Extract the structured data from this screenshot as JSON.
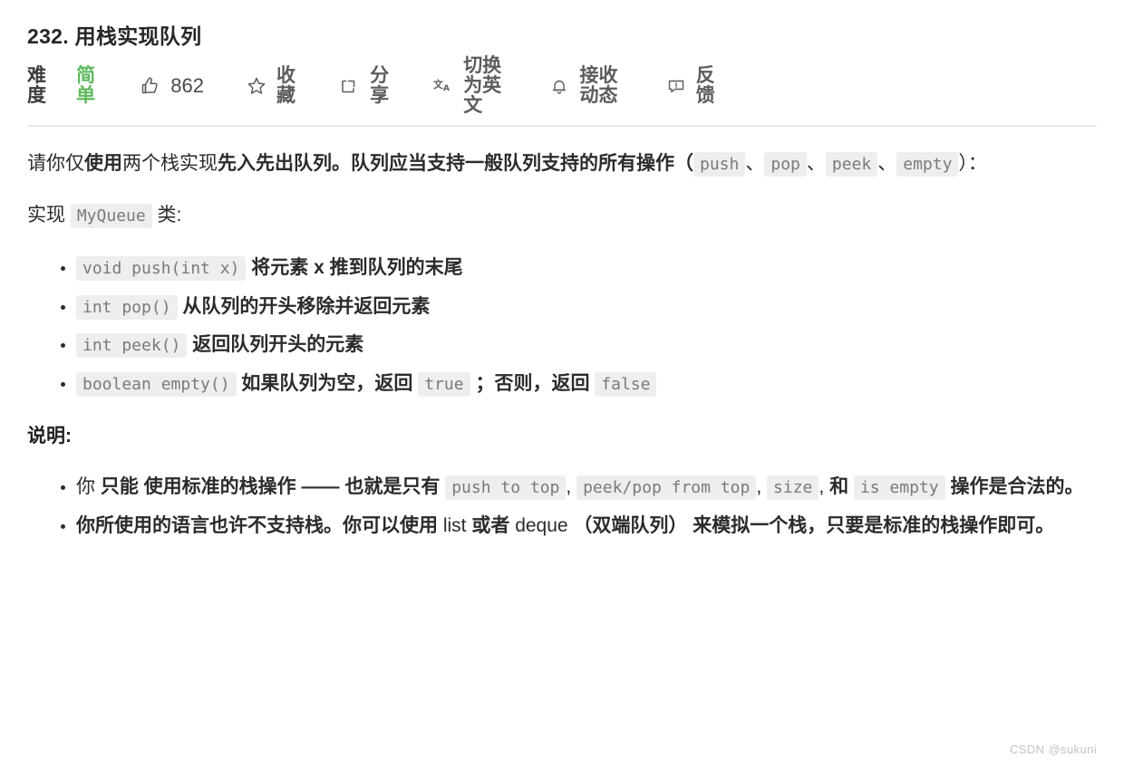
{
  "problem": {
    "title": "232. 用栈实现队列"
  },
  "toolbar": {
    "difficulty_label": "难度",
    "difficulty_value": "简单",
    "like_icon": "thumbs-up-icon",
    "like_count": "862",
    "favorite_icon": "star-icon",
    "favorite_label": "收藏",
    "share_icon": "share-icon",
    "share_label": "分享",
    "translate_icon": "translate-icon",
    "translate_label": "切换为英文",
    "subscribe_icon": "bell-icon",
    "subscribe_label": "接收动态",
    "feedback_icon": "feedback-icon",
    "feedback_label": "反馈"
  },
  "description": {
    "para1_a": "请你仅",
    "para1_b": "使用",
    "para1_c": "两个栈实现",
    "para1_d": "先入先出",
    "para1_e": "队列。队列应当支持一般队列支持的所有操作（",
    "code_push": "push",
    "sep1": "、",
    "code_pop": "pop",
    "sep2": "、",
    "code_peek": "peek",
    "sep3": "、",
    "code_empty": "empty",
    "para1_tail": "）：",
    "para2_a": "实现",
    "code_myqueue": "MyQueue",
    "para2_b": "类:"
  },
  "methods": [
    {
      "code": "void push(int x)",
      "text": "将元素 x 推到队列的末尾"
    },
    {
      "code": "int pop()",
      "text": "从队列的开头移除并返回元素"
    },
    {
      "code": "int peek()",
      "text": "返回队列开头的元素"
    }
  ],
  "method_empty": {
    "code": "boolean empty()",
    "text_a": "如果队列为空，返回",
    "code_true": "true",
    "text_b": "；否则，返回",
    "code_false": "false"
  },
  "notes": {
    "heading": "说明:",
    "note1": {
      "a": "你 ",
      "b": "只能",
      "c": " 使用标准的栈操作 —— 也就是只有 ",
      "code1": "push to top",
      "sep1": ",",
      "code2": "peek/pop from top",
      "sep2": ",",
      "code3": "size",
      "sep3": ",",
      "d": "和",
      "code4": "is empty",
      "e": "操作是合法的。"
    },
    "note2": {
      "a": "你所使用的语言也许不支持栈。你可以使用 ",
      "b": "list",
      "c": " 或者 ",
      "d": "deque",
      "e": " （双端队列） 来模拟一个栈，只要是标准的栈操作即可。"
    }
  },
  "watermark": "CSDN @sukuni",
  "colors": {
    "easy_green": "#5eb95e",
    "code_bg": "#eceef0",
    "code_fg": "#7a7a7a",
    "text": "#2b2b2b",
    "divider": "#e8e8e8",
    "watermark": "#c3c3c3"
  }
}
